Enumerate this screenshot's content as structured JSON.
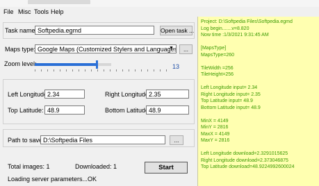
{
  "menu": {
    "file": "File",
    "misc": "Misc",
    "tools": "Tools",
    "help": "Help"
  },
  "task": {
    "label": "Task name:",
    "value": "Softpedia.egmd",
    "open_button": "Open task ..."
  },
  "maps": {
    "label": "Maps type:",
    "value": "Google Maps (Customized Stylers and Languages)",
    "more_button": "..."
  },
  "zoom": {
    "label": "Zoom level:",
    "value": "13",
    "fraction": 0.8
  },
  "coords": {
    "left_lon_label": "Left Longitude:",
    "left_lon_value": "2.34",
    "right_lon_label": "Right Longitude:",
    "right_lon_value": "2.35",
    "top_lat_label": "Top Latitude:",
    "top_lat_value": "48.9",
    "bottom_lat_label": "Bottom Latitude:",
    "bottom_lat_value": "48.9"
  },
  "path": {
    "label": "Path to save:",
    "value": "D:\\Softpedia Files",
    "browse_button": "..."
  },
  "status": {
    "total_images": "Total images: 1",
    "downloaded": "Downloaded: 1",
    "start_button": "Start",
    "message": "Loading server parameters...OK"
  },
  "log": [
    "Project: D:\\Softpedia Files\\Softpedia.egmd",
    "Log begin.......v=8.820",
    "Now time :1/3/2021 9:31:45 AM",
    "",
    "[MapsType]",
    "MapsType=260",
    "",
    "TileWidth =256",
    "TileHeight=256",
    "",
    "Left Longitude  input= 2.34",
    "Right Longitude input= 2.35",
    "Top Latitude    input= 48.9",
    "Bottom Latitude input= 48.9",
    "",
    "MinX = 4149",
    "MinY = 2816",
    "MaxX = 4149",
    "MaxY = 2816",
    "",
    "Left Longitude  download=2.3291015625",
    "Right Longitude download=2.373046875",
    "Top Latitude    download=48.9224992600024"
  ]
}
